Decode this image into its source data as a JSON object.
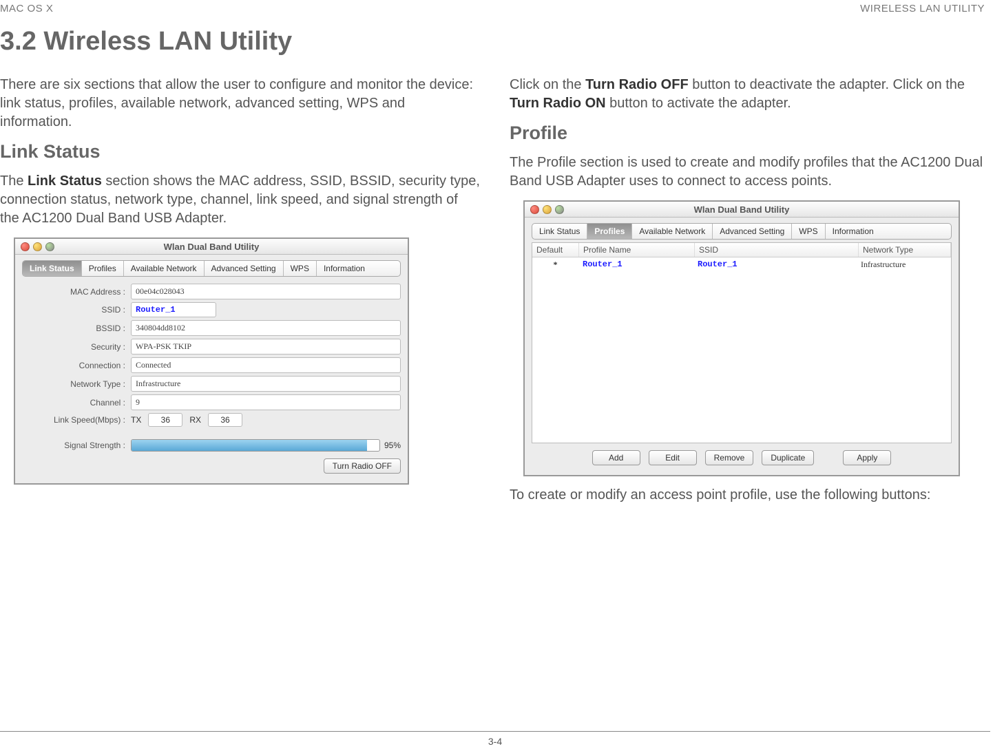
{
  "header": {
    "left": "MAC OS X",
    "right": "WIRELESS LAN UTILITY"
  },
  "title": "3.2 Wireless LAN Utility",
  "left_col": {
    "intro": "There are six sections that allow the user to configure and monitor the device: link status, profiles, available network, advanced setting, WPS and information.",
    "h2": "Link Status",
    "p1a": "The ",
    "p1b_strong": "Link Status",
    "p1c": " section shows the MAC address, SSID, BSSID, security type, connection status, network type, channel, link speed, and signal strength of the AC1200 Dual Band USB Adapter."
  },
  "right_col": {
    "p1a": "Click on the ",
    "p1b_strong": "Turn Radio OFF",
    "p1c": " button to deactivate the adapter. Click on the ",
    "p1d_strong": "Turn Radio ON",
    "p1e": " button to activate the adapter.",
    "h2": "Profile",
    "p2": "The Profile section is used to create and modify profiles that the AC1200 Dual Band USB Adapter uses to connect to access points.",
    "p3": "To create or modify an access point profile, use the following buttons:"
  },
  "shot1": {
    "title": "Wlan Dual Band Utility",
    "tabs": [
      "Link Status",
      "Profiles",
      "Available Network",
      "Advanced Setting",
      "WPS",
      "Information"
    ],
    "active_tab": 0,
    "rows": {
      "mac_l": "MAC Address :",
      "mac_v": "00e04c028043",
      "ssid_l": "SSID :",
      "ssid_v": "Router_1",
      "bssid_l": "BSSID :",
      "bssid_v": "340804dd8102",
      "sec_l": "Security :",
      "sec_v": "WPA-PSK TKIP",
      "conn_l": "Connection :",
      "conn_v": "Connected",
      "nt_l": "Network Type :",
      "nt_v": "Infrastructure",
      "ch_l": "Channel :",
      "ch_v": "9",
      "ls_l": "Link Speed(Mbps) :",
      "tx_l": "TX",
      "tx_v": "36",
      "rx_l": "RX",
      "rx_v": "36",
      "sig_l": "Signal Strength :",
      "sig_pct": "95%"
    },
    "btn": "Turn Radio OFF"
  },
  "shot2": {
    "title": "Wlan Dual Band Utility",
    "tabs": [
      "Link Status",
      "Profiles",
      "Available Network",
      "Advanced Setting",
      "WPS",
      "Information"
    ],
    "active_tab": 1,
    "head": {
      "def": "Default",
      "pn": "Profile Name",
      "ssid": "SSID",
      "nt": "Network Type"
    },
    "row": {
      "def": "*",
      "pn": "Router_1",
      "ssid": "Router_1",
      "nt": "Infrastructure"
    },
    "btns": {
      "add": "Add",
      "edit": "Edit",
      "rem": "Remove",
      "dup": "Duplicate",
      "apply": "Apply"
    }
  },
  "footer": "3-4"
}
